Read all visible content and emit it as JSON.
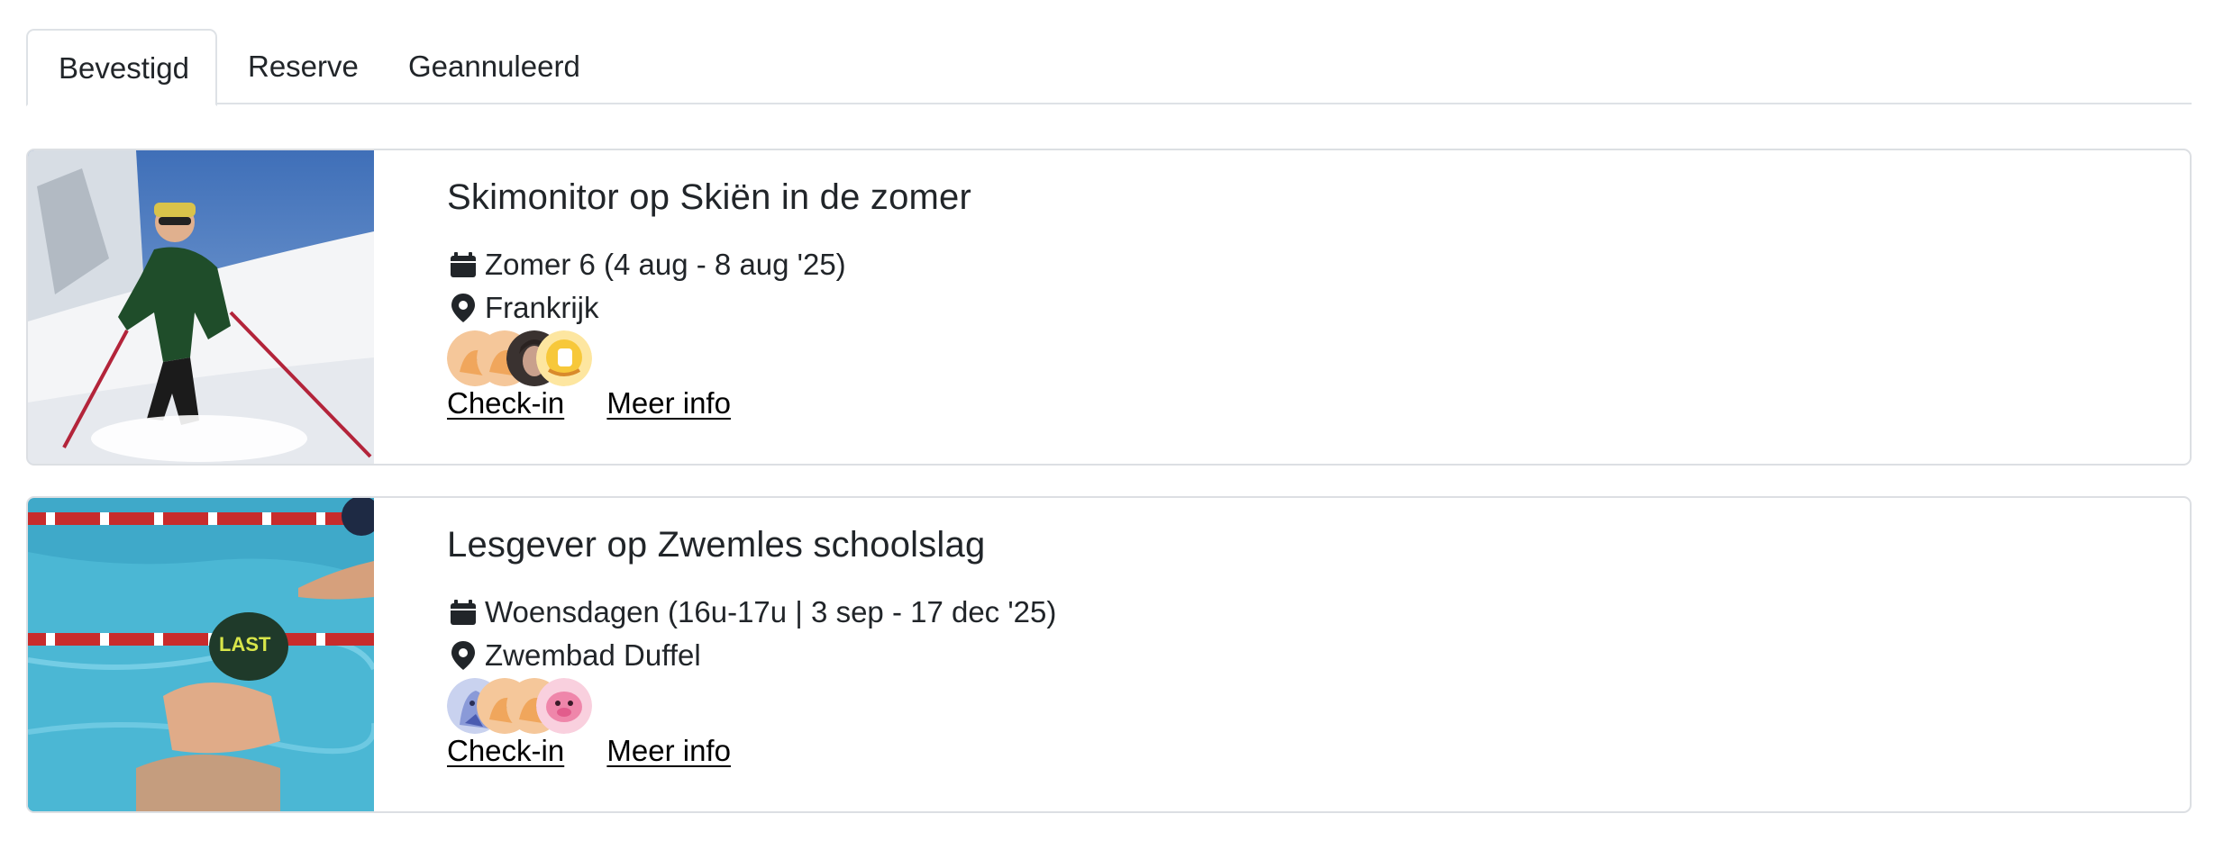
{
  "tabs": [
    {
      "label": "Bevestigd",
      "active": true
    },
    {
      "label": "Reserve",
      "active": false
    },
    {
      "label": "Geannuleerd",
      "active": false
    }
  ],
  "cards": [
    {
      "title": "Skimonitor op Skiën in de zomer",
      "date": "Zomer 6 (4 aug - 8 aug '25)",
      "location": "Frankrijk",
      "checkin_label": "Check-in",
      "info_label": "Meer info",
      "image": "skier-photo",
      "avatars": [
        "orange-cat-avatar",
        "orange-cat-avatar",
        "person-photo-avatar",
        "yellow-blob-avatar"
      ]
    },
    {
      "title": "Lesgever op Zwemles schoolslag",
      "date": "Woensdagen (16u-17u | 3 sep - 17 dec '25)",
      "location": "Zwembad Duffel",
      "checkin_label": "Check-in",
      "info_label": "Meer info",
      "image": "swimmer-photo",
      "avatars": [
        "blue-bird-avatar",
        "orange-cat-avatar",
        "orange-cat-avatar",
        "pink-pig-avatar"
      ]
    }
  ],
  "colors": {
    "text": "#212529",
    "border": "#dee2e6",
    "link": "#000000"
  }
}
